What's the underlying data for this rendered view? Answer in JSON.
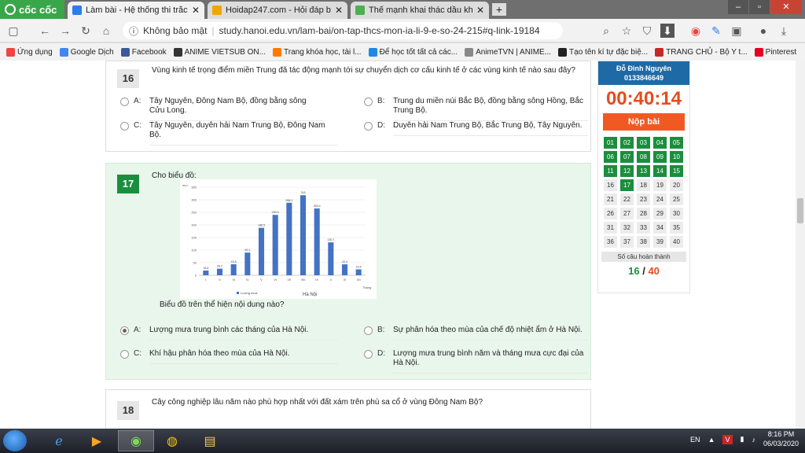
{
  "browser": {
    "brand": "cốc cốc",
    "tabs": [
      {
        "title": "Làm bài - Hệ thống thi trắc n",
        "active": true,
        "icon_color": "#2b7de9"
      },
      {
        "title": "Hoidap247.com - Hỏi đáp bài",
        "active": false,
        "icon_color": "#f0a500"
      },
      {
        "title": "Thế mạnh khai thác dầu khí v",
        "active": false,
        "icon_color": "#4caf50"
      }
    ],
    "new_tab": "+",
    "window_buttons": {
      "minimize": "–",
      "maximize": "▫",
      "close": "✕"
    },
    "security_label": "Không bảo mật",
    "url": "study.hanoi.edu.vn/lam-bai/on-tap-thcs-mon-ia-li-9-e-so-24-215#q-link-19184",
    "bookmarks": [
      {
        "label": "Ứng dụng",
        "color": "#e44"
      },
      {
        "label": "Google Dịch",
        "color": "#4285f4"
      },
      {
        "label": "Facebook",
        "color": "#3b5998"
      },
      {
        "label": "ANIME VIETSUB ON...",
        "color": "#333"
      },
      {
        "label": "Trang khóa học, tài l...",
        "color": "#ff7a00"
      },
      {
        "label": "Để học tốt tất cả các...",
        "color": "#1e88e5"
      },
      {
        "label": "AnimeTVN | ANIME...",
        "color": "#888"
      },
      {
        "label": "Tạo tên kí tự đặc biệ...",
        "color": "#222"
      },
      {
        "label": "TRANG CHỦ - Bộ Y t...",
        "color": "#c62828"
      },
      {
        "label": "Pinterest",
        "color": "#e60023"
      }
    ]
  },
  "questions": {
    "q16": {
      "number": "16",
      "text": "Vùng kinh tế trọng điểm miền Trung đã tác động mạnh tới sự chuyển dịch cơ cấu kinh tế ở các vùng kinh tế nào sau đây?",
      "options": [
        {
          "label": "A:",
          "text": "Tây Nguyên, Đông Nam Bộ, đồng bằng sông Cửu Long."
        },
        {
          "label": "B:",
          "text": "Trung du miền núi Bắc Bộ, đồng bằng sông Hồng, Bắc Trung Bộ."
        },
        {
          "label": "C:",
          "text": "Tây Nguyên, duyên hải Nam Trung Bộ, Đông Nam Bộ."
        },
        {
          "label": "D:",
          "text": "Duyên hải Nam Trung Bộ, Bắc Trung Bộ, Tây Nguyên."
        }
      ]
    },
    "q17": {
      "number": "17",
      "intro": "Cho biểu đồ:",
      "prompt": "Biểu đồ trên thể hiện nội dung nào?",
      "selected": "A:",
      "options": [
        {
          "label": "A:",
          "text": "Lượng mưa trung bình các tháng của Hà Nội."
        },
        {
          "label": "B:",
          "text": "Sự phân hóa theo mùa của chế độ nhiệt ẩm ở Hà Nội."
        },
        {
          "label": "C:",
          "text": "Khí hậu phân hóa theo mùa của Hà Nội."
        },
        {
          "label": "D:",
          "text": "Lượng mưa trung bình năm và tháng mưa cực đại của Hà Nội."
        }
      ]
    },
    "q18": {
      "number": "18",
      "text": "Cây công nghiệp lâu năm nào phù hợp nhất với đất xám trên phù sa cổ ở vùng Đông Nam Bộ?"
    }
  },
  "chart_data": {
    "type": "bar",
    "categories": [
      "I",
      "II",
      "III",
      "IV",
      "V",
      "VI",
      "VII",
      "VIII",
      "IX",
      "X",
      "XI",
      "XII"
    ],
    "values": [
      18.6,
      26.2,
      43.8,
      90.1,
      188.5,
      239.9,
      288.2,
      318,
      265.4,
      130.7,
      43.4,
      23.4
    ],
    "data_labels": [
      "18.6",
      "26.2",
      "43.8",
      "90.1",
      "188.5",
      "239.9",
      "288.2",
      "318",
      "265.4",
      "130.7",
      "43.4",
      "23.4"
    ],
    "series": [
      {
        "name": "Lượng mưa",
        "values": [
          18.6,
          26.2,
          43.8,
          90.1,
          188.5,
          239.9,
          288.2,
          318,
          265.4,
          130.7,
          43.4,
          23.4
        ]
      }
    ],
    "ylabel": "mm",
    "xlabel": "Tháng",
    "caption": "Hà Nội",
    "ylim": [
      0,
      350
    ],
    "yticks": [
      "0",
      "50",
      "100",
      "150",
      "200",
      "250",
      "300",
      "350"
    ],
    "grid": true,
    "legend": "bottom",
    "bar_color": "#4472c4"
  },
  "sidebar": {
    "student_name": "Đỗ Đình Nguyên",
    "student_id": "0133846649",
    "timer": "00:40:14",
    "submit_label": "Nộp bài",
    "numbers": [
      "01",
      "02",
      "03",
      "04",
      "05",
      "06",
      "07",
      "08",
      "09",
      "10",
      "11",
      "12",
      "13",
      "14",
      "15",
      "16",
      "17",
      "18",
      "19",
      "20",
      "21",
      "22",
      "23",
      "24",
      "25",
      "26",
      "27",
      "28",
      "29",
      "30",
      "31",
      "32",
      "33",
      "34",
      "35",
      "36",
      "37",
      "38",
      "39",
      "40"
    ],
    "done_count": 15,
    "done_extra": [
      "17"
    ],
    "caption": "Số câu hoàn thành",
    "answered": "16",
    "separator": "/",
    "total": "40"
  },
  "taskbar": {
    "lang": "EN",
    "time": "8:16 PM",
    "date": "06/03/2020"
  }
}
